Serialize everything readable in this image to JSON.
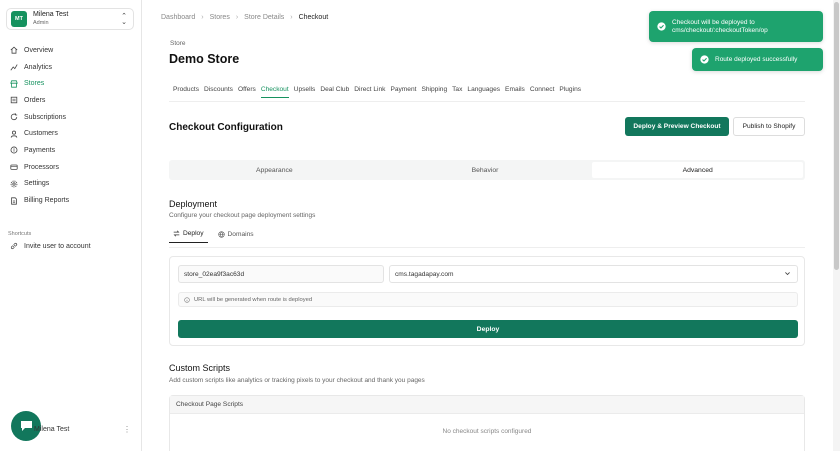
{
  "user": {
    "initials": "MT",
    "name": "Milena Test",
    "role": "Admin"
  },
  "sidebar": {
    "items": [
      {
        "label": "Overview",
        "icon": "home-icon"
      },
      {
        "label": "Analytics",
        "icon": "chart-icon"
      },
      {
        "label": "Stores",
        "icon": "store-icon",
        "active": true
      },
      {
        "label": "Orders",
        "icon": "orders-icon"
      },
      {
        "label": "Subscriptions",
        "icon": "refresh-icon"
      },
      {
        "label": "Customers",
        "icon": "user-icon"
      },
      {
        "label": "Payments",
        "icon": "card-icon"
      },
      {
        "label": "Processors",
        "icon": "processor-icon"
      },
      {
        "label": "Settings",
        "icon": "gear-icon"
      },
      {
        "label": "Billing Reports",
        "icon": "report-icon"
      }
    ],
    "shortcuts_title": "Shortcuts",
    "shortcut_invite": "Invite user to account",
    "bottom_user": "Milena Test"
  },
  "breadcrumb": {
    "items": [
      "Dashboard",
      "Stores",
      "Store Details",
      "Checkout"
    ]
  },
  "store": {
    "label": "Store",
    "title": "Demo Store"
  },
  "tabs": [
    "Products",
    "Discounts",
    "Offers",
    "Checkout",
    "Upsells",
    "Deal Club",
    "Direct Link",
    "Payment",
    "Shipping",
    "Tax",
    "Languages",
    "Emails",
    "Connect",
    "Plugins"
  ],
  "active_tab": "Checkout",
  "config": {
    "title": "Checkout Configuration",
    "deploy_preview_label": "Deploy & Preview Checkout",
    "publish_label": "Publish to Shopify",
    "segments": [
      "Appearance",
      "Behavior",
      "Advanced"
    ],
    "active_segment": "Advanced"
  },
  "deployment": {
    "title": "Deployment",
    "subtitle": "Configure your checkout page deployment settings",
    "subtabs": [
      "Deploy",
      "Domains"
    ],
    "store_value": "store_02ea9f3ac63d",
    "domain_value": "cms.tagadapay.com",
    "info": "URL will be generated when route is deployed",
    "deploy_label": "Deploy"
  },
  "custom_scripts": {
    "title": "Custom Scripts",
    "subtitle": "Add custom scripts like analytics or tracking pixels to your checkout and thank you pages",
    "table_header": "Checkout Page Scripts",
    "empty": "No checkout scripts configured"
  },
  "toasts": {
    "first_line1": "Checkout will be deployed to",
    "first_line2": "cms/checkout/:checkoutToken/op",
    "second": "Route deployed successfully"
  },
  "colors": {
    "brand": "#12775c",
    "accent": "#16925f",
    "toast": "#1ea36e"
  }
}
